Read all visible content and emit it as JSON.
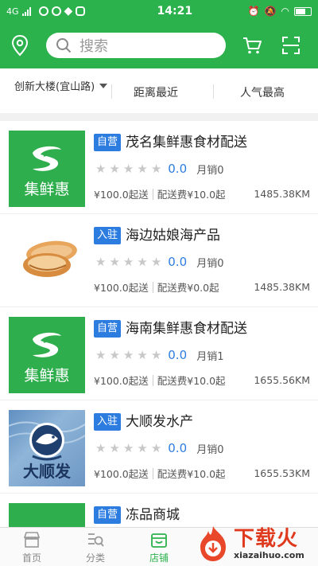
{
  "status_bar": {
    "network": "4G",
    "time": "14:21"
  },
  "header": {
    "search_placeholder": "搜索"
  },
  "filters": {
    "location": "创新大楼(宜山路)",
    "distance": "距离最近",
    "popularity": "人气最高"
  },
  "stores": [
    {
      "tag": "自营",
      "name": "茂名集鲜惠食材配送",
      "score": "0.0",
      "monthly": "月销0",
      "min_order": "¥100.0起送",
      "delivery_fee": "配送费¥10.0起",
      "distance": "1485.38KM",
      "thumb": "jixianhui-logo",
      "logo_text": "集鲜惠"
    },
    {
      "tag": "入驻",
      "name": "海边姑娘海产品",
      "score": "0.0",
      "monthly": "月销0",
      "min_order": "¥100.0起送",
      "delivery_fee": "配送费¥0.0起",
      "distance": "1485.38KM",
      "thumb": "shellfish-photo"
    },
    {
      "tag": "自营",
      "name": "海南集鲜惠食材配送",
      "score": "0.0",
      "monthly": "月销1",
      "min_order": "¥100.0起送",
      "delivery_fee": "配送费¥10.0起",
      "distance": "1655.56KM",
      "thumb": "jixianhui-logo",
      "logo_text": "集鲜惠"
    },
    {
      "tag": "入驻",
      "name": "大顺发水产",
      "score": "0.0",
      "monthly": "月销0",
      "min_order": "¥100.0起送",
      "delivery_fee": "配送费¥10.0起",
      "distance": "1655.53KM",
      "thumb": "dashunfa-logo",
      "logo_text": "大顺发"
    },
    {
      "tag": "自营",
      "name": "冻品商城",
      "score": "",
      "monthly": "",
      "min_order": "",
      "delivery_fee": "",
      "distance": "",
      "thumb": "",
      "logo_text": ""
    }
  ],
  "bottom_nav": [
    {
      "label": "首页",
      "icon": "home-store-icon"
    },
    {
      "label": "分类",
      "icon": "category-icon"
    },
    {
      "label": "店铺",
      "icon": "shop-icon",
      "active": true
    }
  ],
  "watermark": {
    "cn": "下载火",
    "en": "xiazaihuo.com"
  },
  "colors": {
    "brand_green": "#2bb24c",
    "tag_blue": "#2d7de0",
    "watermark_red": "#e03a1e"
  }
}
